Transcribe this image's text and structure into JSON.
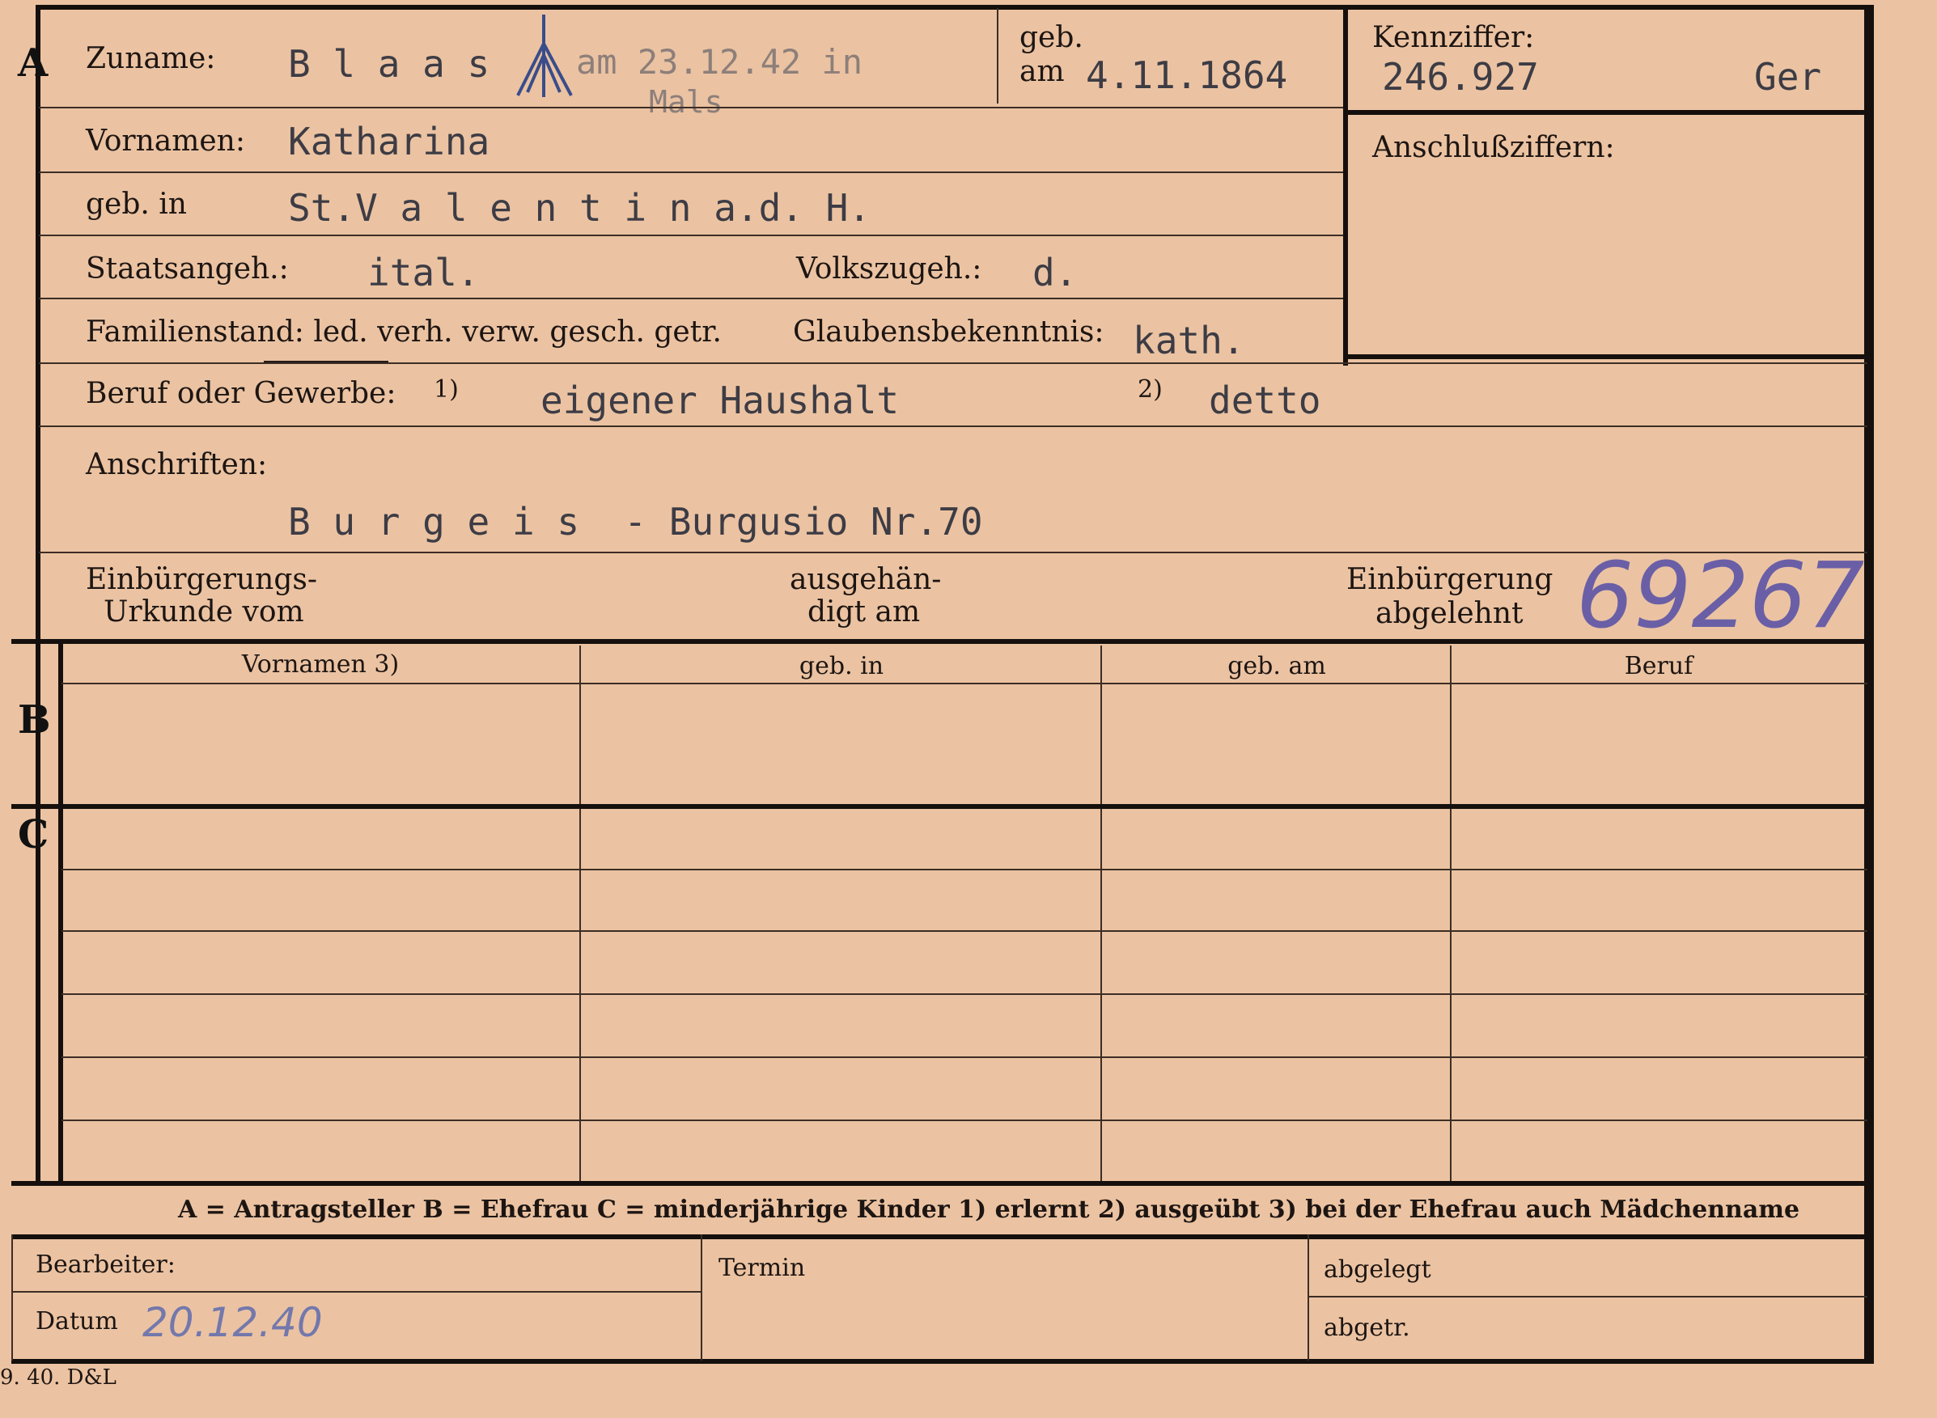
{
  "sections": {
    "a": "A",
    "b": "B",
    "c": "C"
  },
  "labels": {
    "zuname": "Zuname:",
    "geb_am_top": "geb.",
    "geb_am_bottom": "am",
    "kennziffer": "Kennziffer:",
    "vornamen": "Vornamen:",
    "anschlussziffern": "Anschlußziffern:",
    "geb_in": "geb. in",
    "staatsangeh": "Staatsangeh.:",
    "volkszugeh": "Volkszugeh.:",
    "familienstand": "Familienstand: led. verh. verw. gesch. getr.",
    "glaubensbekenntnis": "Glaubensbekenntnis:",
    "beruf": "Beruf oder Gewerbe:",
    "beruf_note1": "1)",
    "beruf_note2": "2)",
    "anschriften": "Anschriften:",
    "einbuergerungs_1": "Einbürgerungs-",
    "einbuergerungs_2": "Urkunde vom",
    "ausgehaendigt_1": "ausgehän-",
    "ausgehaendigt_2": "digt am",
    "abgelehnt_1": "Einbürgerung",
    "abgelehnt_2": "abgelehnt",
    "bearbeiter": "Bearbeiter:",
    "datum": "Datum",
    "termin": "Termin",
    "abgelegt": "abgelegt",
    "abgetr": "abgetr."
  },
  "table_headers": [
    "Vornamen 3)",
    "geb. in",
    "geb. am",
    "Beruf"
  ],
  "values": {
    "zuname": "B l a a s",
    "death_note_1": "am 23.12.42 in",
    "death_note_2": "Mals",
    "geb_am": "4.11.1864",
    "kennziffer": "246.927",
    "kennziffer_suffix": "Ger",
    "vornamen": "Katharina",
    "geb_in": "St.V a l e n t i n a.d. H.",
    "staatsangeh": "ital.",
    "volkszugeh": "d.",
    "glaubensbekenntnis": "kath.",
    "beruf_erlernt": "eigener Haushalt",
    "beruf_ausgeuebt": "detto",
    "anschrift": "B u r g e i s  - Burgusio Nr.70",
    "handwritten_number": "69267",
    "datum": "20.12.40"
  },
  "legend": "A = Antragsteller   B = Ehefrau   C = minderjährige Kinder   1) erlernt   2) ausgeübt   3) bei der Ehefrau auch Mädchenname",
  "print_code": "9. 40. D&L",
  "colors": {
    "card": "#ebc3a2",
    "ink": "#1d1512",
    "typewriter": "#3d3c45",
    "pencil": "#6e6bb0"
  }
}
